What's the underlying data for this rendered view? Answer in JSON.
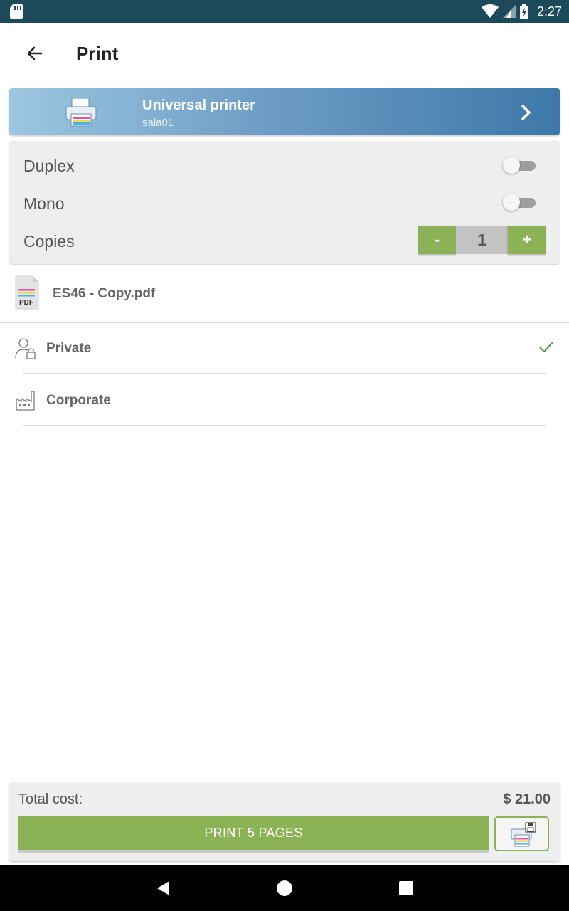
{
  "status_bar": {
    "time": "2:27"
  },
  "app_bar": {
    "title": "Print"
  },
  "printer": {
    "name": "Universal printer",
    "location": "sala01"
  },
  "options": {
    "duplex_label": "Duplex",
    "duplex_on": false,
    "mono_label": "Mono",
    "mono_on": false,
    "copies_label": "Copies",
    "copies_value": "1",
    "decrement_label": "-",
    "increment_label": "+"
  },
  "file": {
    "name": "ES46 - Copy.pdf",
    "icon_text": "PDF"
  },
  "accounts": [
    {
      "name": "Private",
      "selected": true
    },
    {
      "name": "Corporate",
      "selected": false
    }
  ],
  "footer": {
    "total_label": "Total cost:",
    "total_value": "$ 21.00",
    "print_button": "PRINT 5 PAGES"
  },
  "colors": {
    "accent": "#8bb356",
    "status_bar": "#1d4a5a",
    "printer_gradient_start": "#9cc6e0",
    "printer_gradient_end": "#3d78a8"
  }
}
